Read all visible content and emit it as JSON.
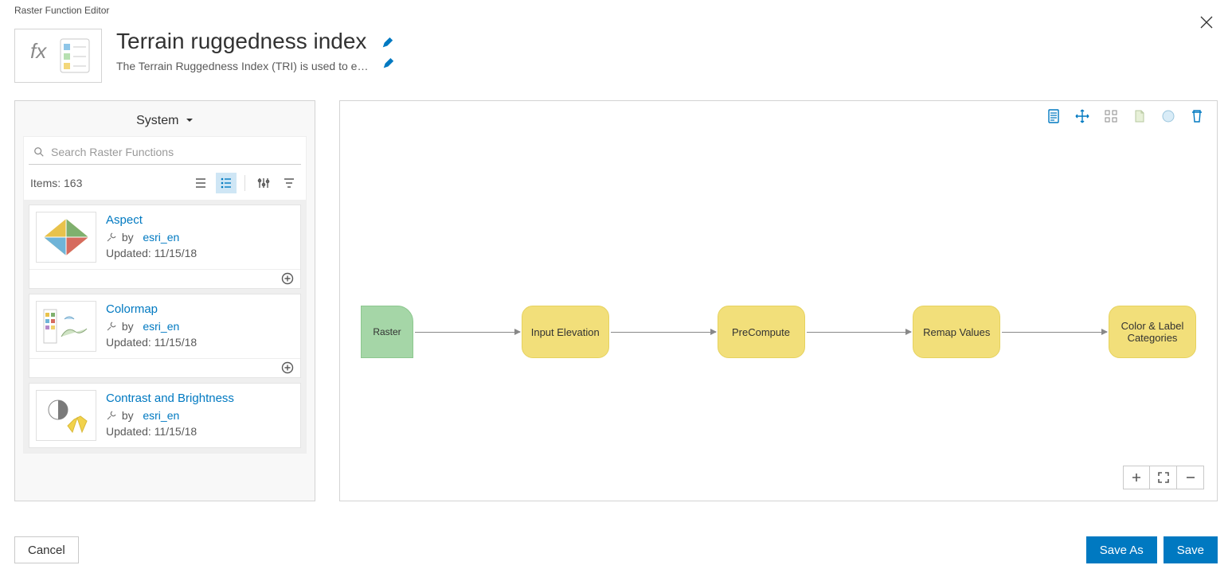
{
  "window_label": "Raster Function Editor",
  "title": "Terrain ruggedness index",
  "subtitle": "The Terrain Ruggedness Index (TRI) is used to expres…",
  "sidebar": {
    "category_label": "System",
    "search_placeholder": "Search Raster Functions",
    "items_count_label": "Items: 163",
    "by_label": "by",
    "items": [
      {
        "name": "Aspect",
        "owner": "esri_en",
        "updated": "Updated: 11/15/18",
        "has_add": true
      },
      {
        "name": "Colormap",
        "owner": "esri_en",
        "updated": "Updated: 11/15/18",
        "has_add": true
      },
      {
        "name": "Contrast and Brightness",
        "owner": "esri_en",
        "updated": "Updated: 11/15/18",
        "has_add": false
      }
    ]
  },
  "canvas": {
    "nodes": [
      {
        "kind": "raster",
        "label": "Raster"
      },
      {
        "kind": "fn",
        "label": "Input Elevation"
      },
      {
        "kind": "fn",
        "label": "PreCompute"
      },
      {
        "kind": "fn",
        "label": "Remap Values"
      },
      {
        "kind": "fn",
        "label": "Color & Label Categories"
      }
    ]
  },
  "footer": {
    "cancel": "Cancel",
    "save_as": "Save As",
    "save": "Save"
  }
}
